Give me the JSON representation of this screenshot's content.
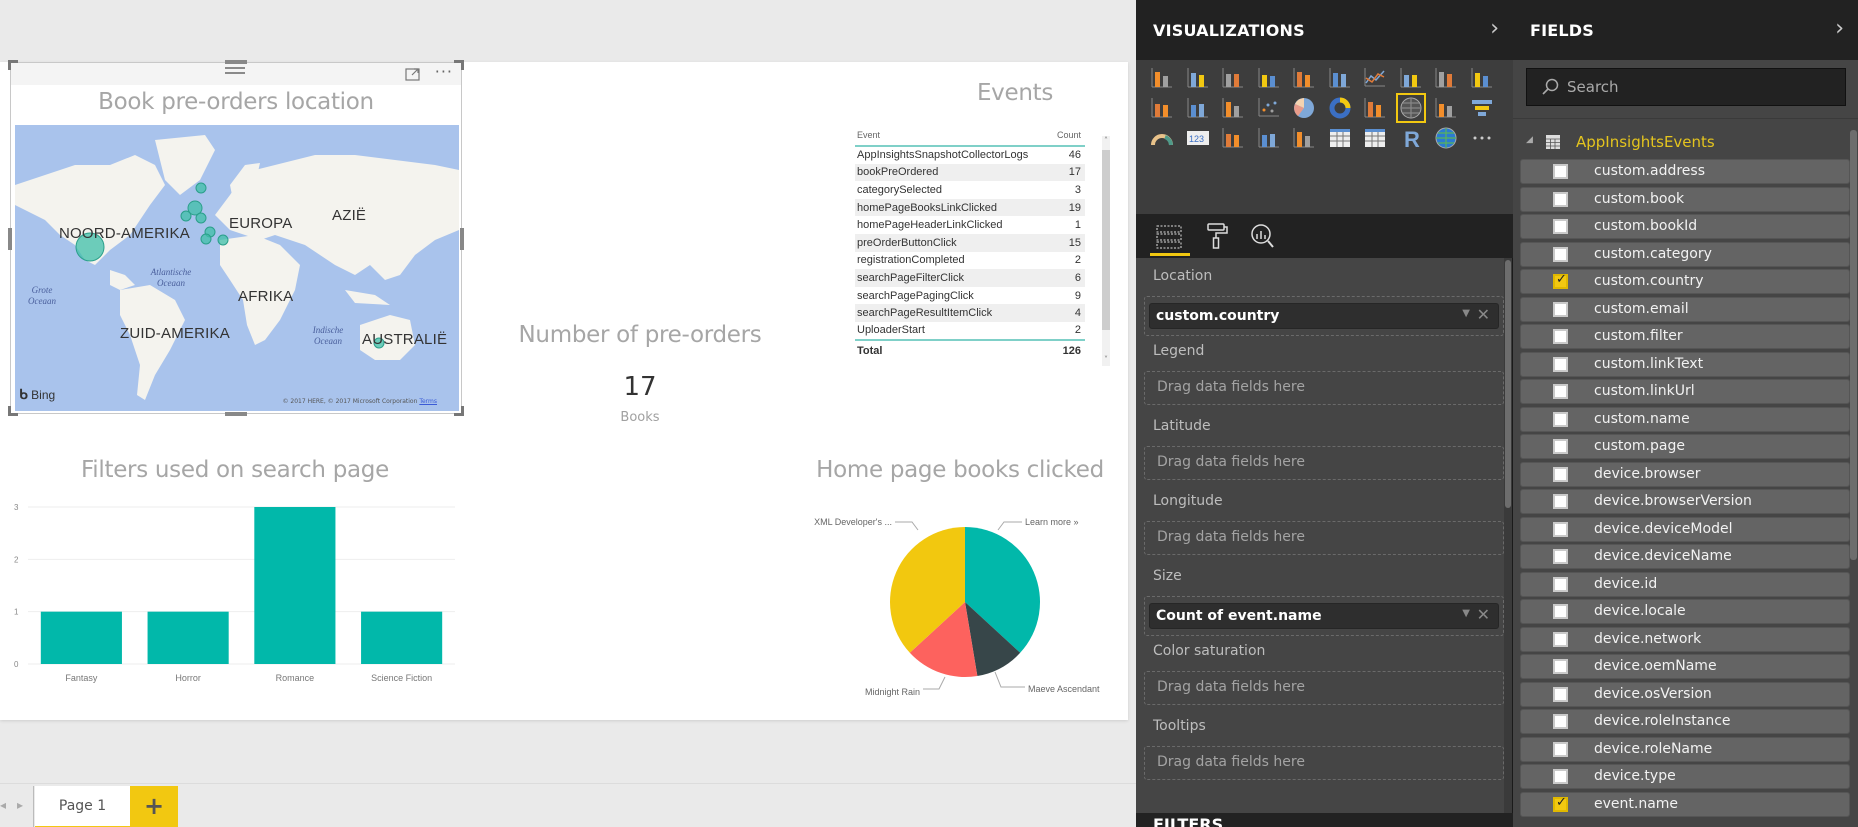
{
  "canvas": {
    "map": {
      "title": "Book pre-orders location",
      "continents": [
        "NOORD-AMERIKA",
        "EUROPA",
        "AZIË",
        "AFRIKA",
        "ZUID-AMERIKA",
        "AUSTRALIË"
      ],
      "oceans": [
        "Grote Oceaan",
        "Atlantische Oceaan",
        "Indische Oceaan"
      ],
      "bing_label": "Bing",
      "copyright": "© 2017 HERE, © 2017 Microsoft Corporation",
      "terms_link": "Terms",
      "bubble_color": "#3fbfa8"
    },
    "card": {
      "title": "Number of pre-orders",
      "value": "17",
      "label": "Books"
    },
    "events": {
      "title": "Events",
      "columns": [
        "Event",
        "Count"
      ],
      "rows": [
        {
          "event": "AppInsightsSnapshotCollectorLogs",
          "count": "46"
        },
        {
          "event": "bookPreOrdered",
          "count": "17"
        },
        {
          "event": "categorySelected",
          "count": "3"
        },
        {
          "event": "homePageBooksLinkClicked",
          "count": "19"
        },
        {
          "event": "homePageHeaderLinkClicked",
          "count": "1"
        },
        {
          "event": "preOrderButtonClick",
          "count": "15"
        },
        {
          "event": "registrationCompleted",
          "count": "2"
        },
        {
          "event": "searchPageFilterClick",
          "count": "6"
        },
        {
          "event": "searchPagePagingClick",
          "count": "9"
        },
        {
          "event": "searchPageResultItemClick",
          "count": "4"
        },
        {
          "event": "UploaderStart",
          "count": "2"
        }
      ],
      "total_label": "Total",
      "total_value": "126"
    }
  },
  "chart_data": [
    {
      "type": "bar",
      "title": "Filters used on search page",
      "categories": [
        "Fantasy",
        "Horror",
        "Romance",
        "Science Fiction"
      ],
      "values": [
        1,
        1,
        3,
        1
      ],
      "xlabel": "",
      "ylabel": "",
      "ylim": [
        0,
        3
      ],
      "yticks": [
        0,
        1,
        2,
        3
      ],
      "grid": true,
      "color": "#01b8aa"
    },
    {
      "type": "pie",
      "title": "Home page books clicked",
      "categories": [
        "Learn more »",
        "Maeve Ascendant",
        "Midnight Rain",
        "XML Developer's ..."
      ],
      "values": [
        7,
        2,
        3,
        7
      ],
      "colors": [
        "#01b8aa",
        "#374649",
        "#fd625e",
        "#f2c80f"
      ]
    }
  ],
  "page_tabs": {
    "tabs": [
      "Page 1"
    ],
    "add_label": "+"
  },
  "visualizations": {
    "title": "VISUALIZATIONS",
    "collapse_icon": "chevron-right-icon",
    "gallery": [
      "stacked-bar-chart",
      "stacked-column-chart",
      "clustered-bar-chart",
      "clustered-column-chart",
      "100-stacked-bar-chart",
      "100-stacked-column-chart",
      "line-chart",
      "area-chart",
      "stacked-area-chart",
      "line-and-stacked-column-chart",
      "line-and-clustered-column-chart",
      "ribbon-chart",
      "waterfall-chart",
      "scatter-chart",
      "pie-chart",
      "donut-chart",
      "treemap",
      "map",
      "filled-map",
      "funnel",
      "gauge",
      "card",
      "multi-row-card",
      "kpi",
      "slicer",
      "table",
      "matrix",
      "r-script-visual",
      "arcgis-map",
      "more-visuals"
    ],
    "selected": "map",
    "tabs": [
      "fields-tab",
      "format-tab",
      "analytics-tab"
    ],
    "active_tab": "fields-tab",
    "wells": [
      {
        "label": "Location",
        "field": "custom.country"
      },
      {
        "label": "Legend",
        "placeholder": "Drag data fields here"
      },
      {
        "label": "Latitude",
        "placeholder": "Drag data fields here"
      },
      {
        "label": "Longitude",
        "placeholder": "Drag data fields here"
      },
      {
        "label": "Size",
        "field": "Count of event.name"
      },
      {
        "label": "Color saturation",
        "placeholder": "Drag data fields here"
      },
      {
        "label": "Tooltips",
        "placeholder": "Drag data fields here"
      }
    ],
    "filters_title": "FILTERS"
  },
  "fields": {
    "title": "FIELDS",
    "search_placeholder": "Search",
    "table_name": "AppInsightsEvents",
    "items": [
      {
        "name": "custom.address",
        "checked": false
      },
      {
        "name": "custom.book",
        "checked": false
      },
      {
        "name": "custom.bookId",
        "checked": false
      },
      {
        "name": "custom.category",
        "checked": false
      },
      {
        "name": "custom.country",
        "checked": true
      },
      {
        "name": "custom.email",
        "checked": false
      },
      {
        "name": "custom.filter",
        "checked": false
      },
      {
        "name": "custom.linkText",
        "checked": false
      },
      {
        "name": "custom.linkUrl",
        "checked": false
      },
      {
        "name": "custom.name",
        "checked": false
      },
      {
        "name": "custom.page",
        "checked": false
      },
      {
        "name": "device.browser",
        "checked": false
      },
      {
        "name": "device.browserVersion",
        "checked": false
      },
      {
        "name": "device.deviceModel",
        "checked": false
      },
      {
        "name": "device.deviceName",
        "checked": false
      },
      {
        "name": "device.id",
        "checked": false
      },
      {
        "name": "device.locale",
        "checked": false
      },
      {
        "name": "device.network",
        "checked": false
      },
      {
        "name": "device.oemName",
        "checked": false
      },
      {
        "name": "device.osVersion",
        "checked": false
      },
      {
        "name": "device.roleInstance",
        "checked": false
      },
      {
        "name": "device.roleName",
        "checked": false
      },
      {
        "name": "device.type",
        "checked": false
      },
      {
        "name": "event.name",
        "checked": true
      }
    ]
  }
}
